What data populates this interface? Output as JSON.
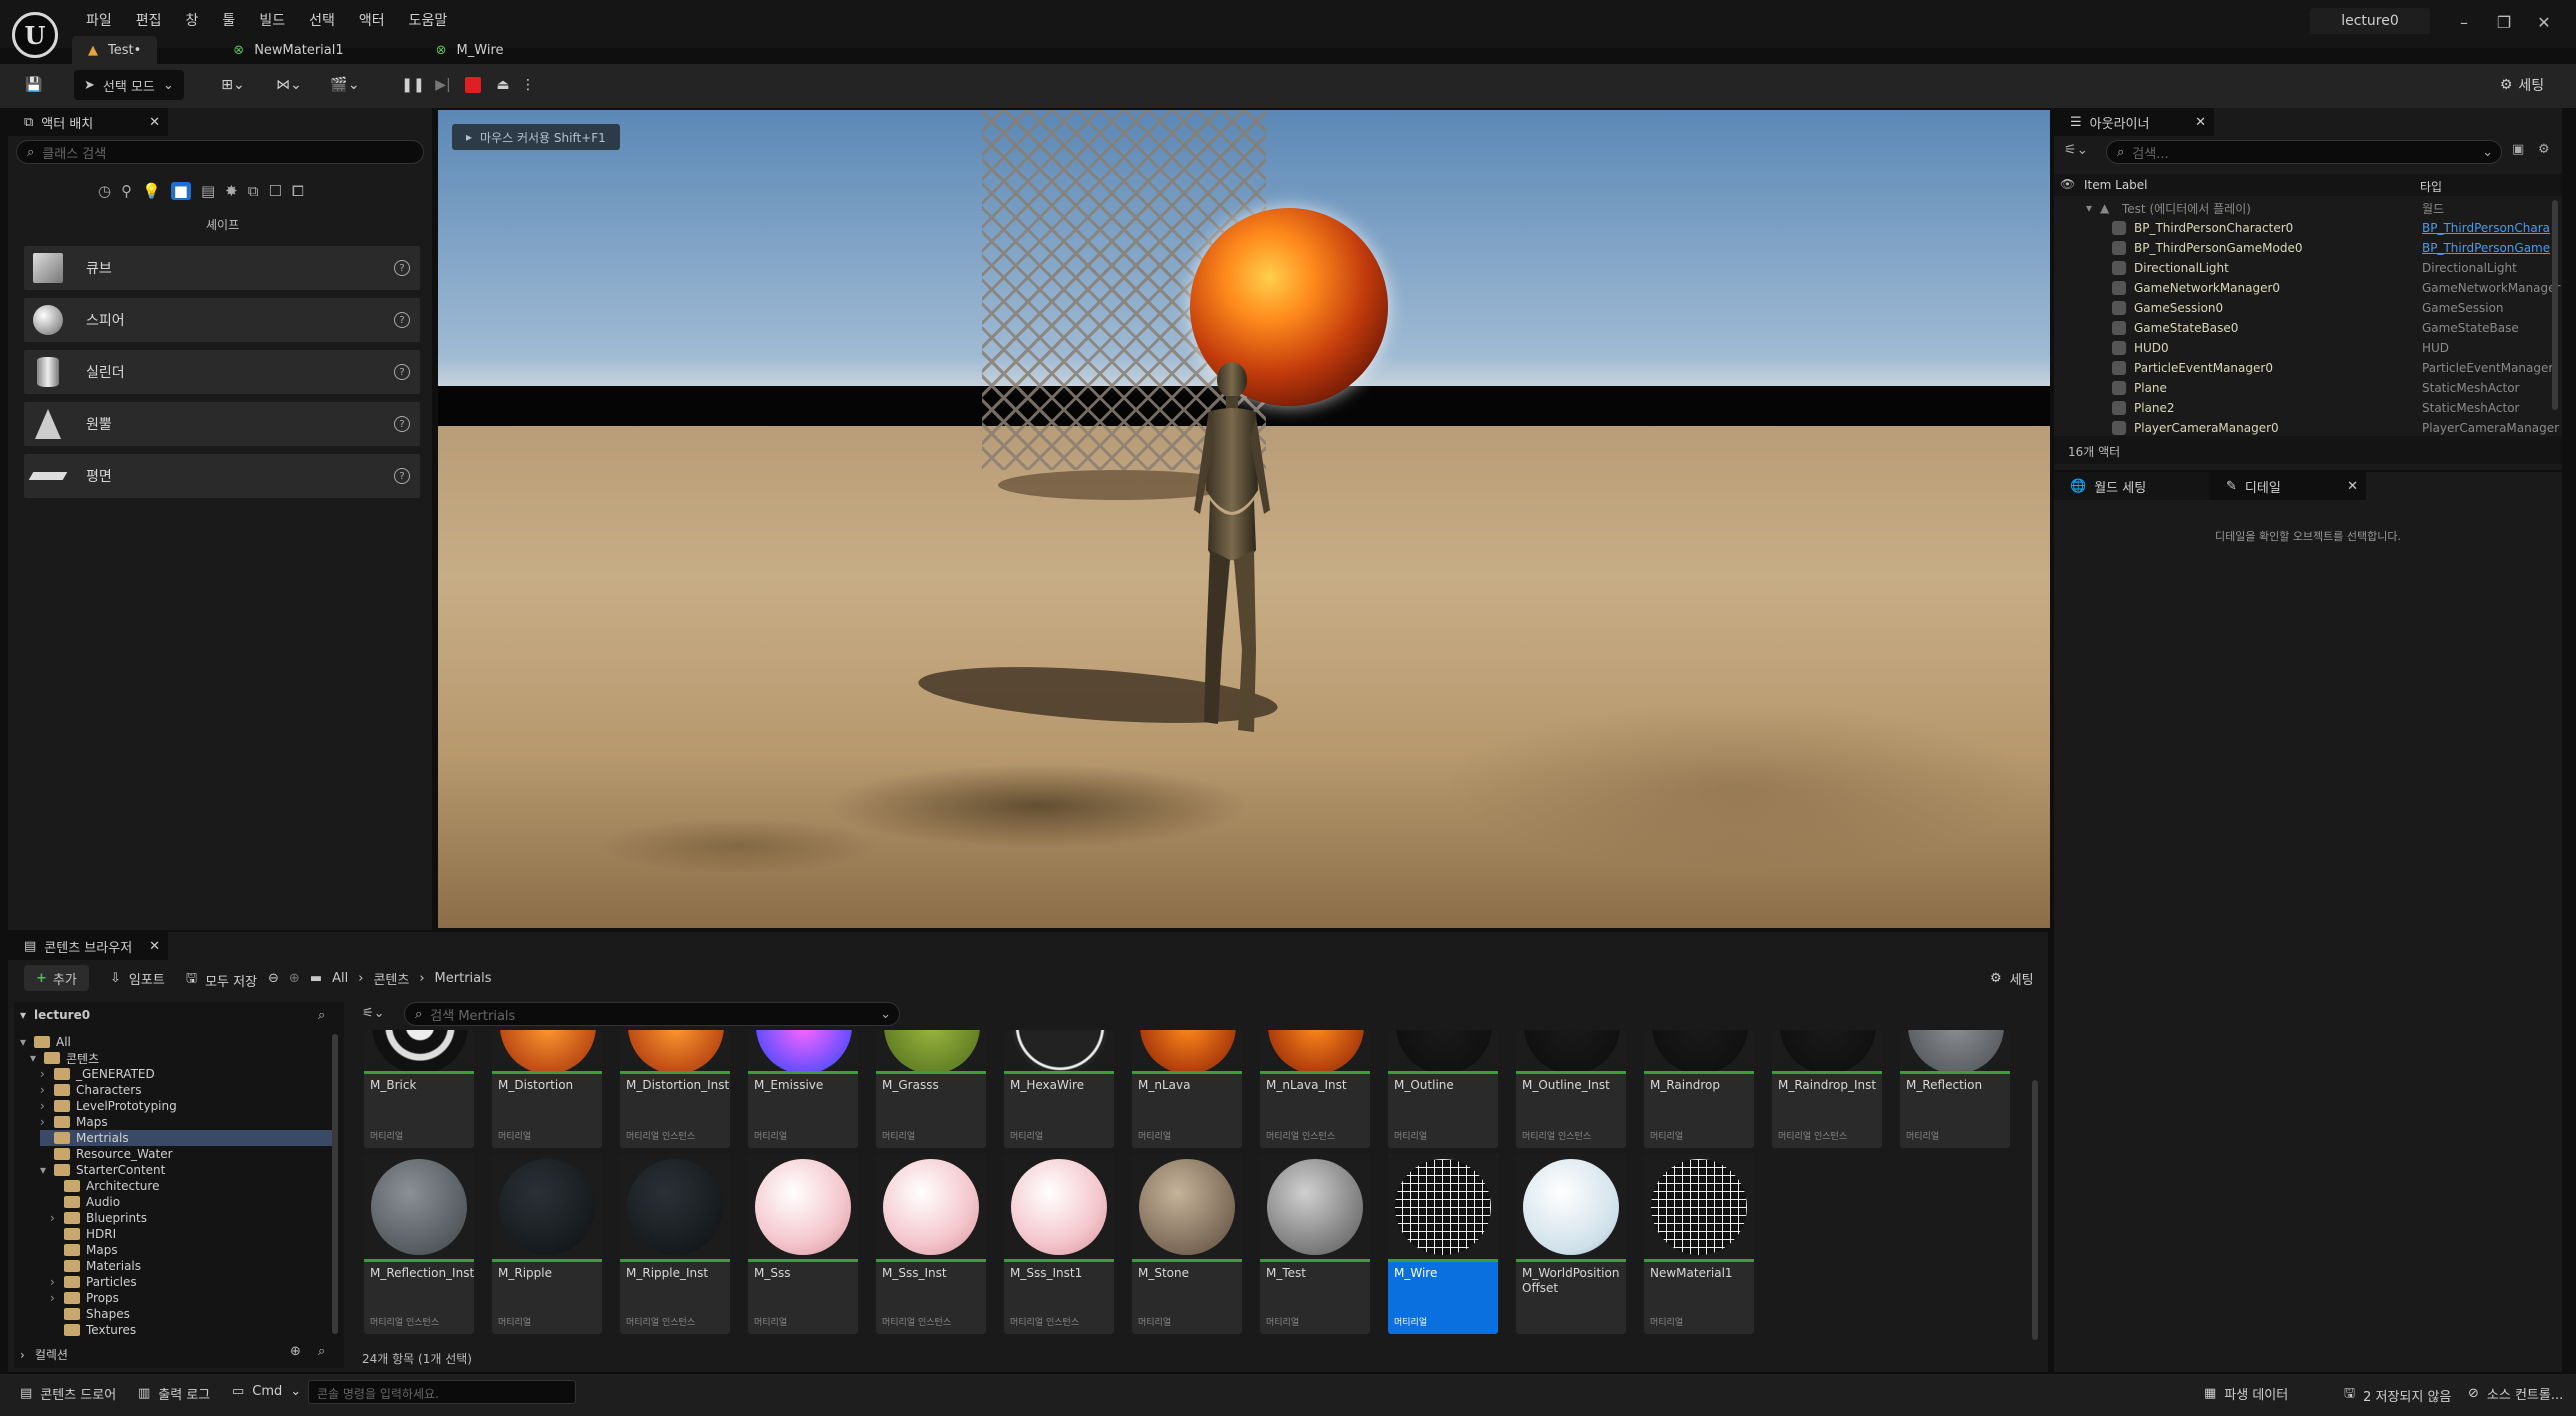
{
  "menus": [
    "파일",
    "편집",
    "창",
    "툴",
    "빌드",
    "선택",
    "액터",
    "도움말"
  ],
  "project_name": "lecture0",
  "tabs": [
    {
      "label": "Test•"
    },
    {
      "label": "NewMaterial1"
    },
    {
      "label": "M_Wire"
    }
  ],
  "toolbar": {
    "mode_label": "선택 모드",
    "settings_label": "세팅"
  },
  "place_actors": {
    "title": "액터 배치",
    "search_placeholder": "클래스 검색",
    "category_label": "셰이프",
    "items": [
      "큐브",
      "스피어",
      "실린더",
      "원뿔",
      "평면"
    ]
  },
  "viewport": {
    "hint": "마우스 커서용 Shift+F1"
  },
  "outliner": {
    "title": "아웃라이너",
    "search_placeholder": "검색...",
    "col_label": "Item Label",
    "col_type": "타입",
    "root_label": "Test (에디터에서 플레이)",
    "root_type": "월드",
    "rows": [
      {
        "name": "BP_ThirdPersonCharacter0",
        "type": "BP_ThirdPersonChara",
        "link": true
      },
      {
        "name": "BP_ThirdPersonGameMode0",
        "type": "BP_ThirdPersonGame",
        "link": true
      },
      {
        "name": "DirectionalLight",
        "type": "DirectionalLight",
        "link": false
      },
      {
        "name": "GameNetworkManager0",
        "type": "GameNetworkManager",
        "link": false
      },
      {
        "name": "GameSession0",
        "type": "GameSession",
        "link": false
      },
      {
        "name": "GameStateBase0",
        "type": "GameStateBase",
        "link": false
      },
      {
        "name": "HUD0",
        "type": "HUD",
        "link": false
      },
      {
        "name": "ParticleEventManager0",
        "type": "ParticleEventManager",
        "link": false
      },
      {
        "name": "Plane",
        "type": "StaticMeshActor",
        "link": false
      },
      {
        "name": "Plane2",
        "type": "StaticMeshActor",
        "link": false
      },
      {
        "name": "PlayerCameraManager0",
        "type": "PlayerCameraManager",
        "link": false
      }
    ],
    "count": "16개 액터"
  },
  "details": {
    "world_tab": "월드 세팅",
    "details_tab": "디테일",
    "empty_msg": "디테일을 확인할 오브젝트를 선택합니다."
  },
  "content_browser": {
    "title": "콘텐츠 브라우저",
    "add_label": "추가",
    "import_label": "임포트",
    "save_all_label": "모두 저장",
    "breadcrumb": [
      "All",
      "콘텐츠",
      "Mertrials"
    ],
    "settings_label": "세팅",
    "tree_root": "lecture0",
    "tree": [
      "All",
      "콘텐츠",
      "_GENERATED",
      "Characters",
      "LevelPrototyping",
      "Maps",
      "Mertrials",
      "Resource_Water",
      "StarterContent",
      "Architecture",
      "Audio",
      "Blueprints",
      "HDRI",
      "Maps",
      "Materials",
      "Particles",
      "Props",
      "Shapes",
      "Textures"
    ],
    "collections_label": "컬렉션",
    "search_placeholder": "검색 Mertrials",
    "top_assets": [
      {
        "name": "M_Brick",
        "sub": "머티리얼"
      },
      {
        "name": "M_Distortion",
        "sub": "머티리얼"
      },
      {
        "name": "M_Distortion_Inst",
        "sub": "머티리얼 인스턴스"
      },
      {
        "name": "M_Emissive",
        "sub": "머티리얼"
      },
      {
        "name": "M_Grasss",
        "sub": "머티리얼"
      },
      {
        "name": "M_HexaWire",
        "sub": "머티리얼"
      },
      {
        "name": "M_nLava",
        "sub": "머티리얼"
      },
      {
        "name": "M_nLava_Inst",
        "sub": "머티리얼 인스턴스"
      },
      {
        "name": "M_Outline",
        "sub": "머티리얼"
      },
      {
        "name": "M_Outline_Inst",
        "sub": "머티리얼 인스턴스"
      },
      {
        "name": "M_Raindrop",
        "sub": "머티리얼"
      },
      {
        "name": "M_Raindrop_Inst",
        "sub": "머티리얼 인스턴스"
      },
      {
        "name": "M_Reflection",
        "sub": "머티리얼"
      }
    ],
    "bottom_assets": [
      {
        "name": "M_Reflection_Inst",
        "sub": "머티리얼 인스턴스"
      },
      {
        "name": "M_Ripple",
        "sub": "머티리얼"
      },
      {
        "name": "M_Ripple_Inst",
        "sub": "머티리얼 인스턴스"
      },
      {
        "name": "M_Sss",
        "sub": "머티리얼"
      },
      {
        "name": "M_Sss_Inst",
        "sub": "머티리얼 인스턴스"
      },
      {
        "name": "M_Sss_Inst1",
        "sub": "머티리얼 인스턴스"
      },
      {
        "name": "M_Stone",
        "sub": "머티리얼"
      },
      {
        "name": "M_Test",
        "sub": "머티리얼"
      },
      {
        "name": "M_Wire",
        "sub": "머티리얼"
      },
      {
        "name": "M_WorldPosition Offset",
        "sub": ""
      },
      {
        "name": "NewMaterial1",
        "sub": "머티리얼"
      }
    ],
    "item_count": "24개 항목 (1개 선택)"
  },
  "statusbar": {
    "content_drawer": "콘텐츠 드로어",
    "output_log": "출력 로그",
    "cmd": "Cmd",
    "console_placeholder": "콘솔 명령을 입력하세요.",
    "derived_data": "파생 데이터",
    "unsaved": "2 저장되지 않음",
    "source_control": "소스 컨트롤..."
  },
  "colors": {
    "accent": "#0a70e0",
    "material_bar": "#3a9f3a"
  }
}
